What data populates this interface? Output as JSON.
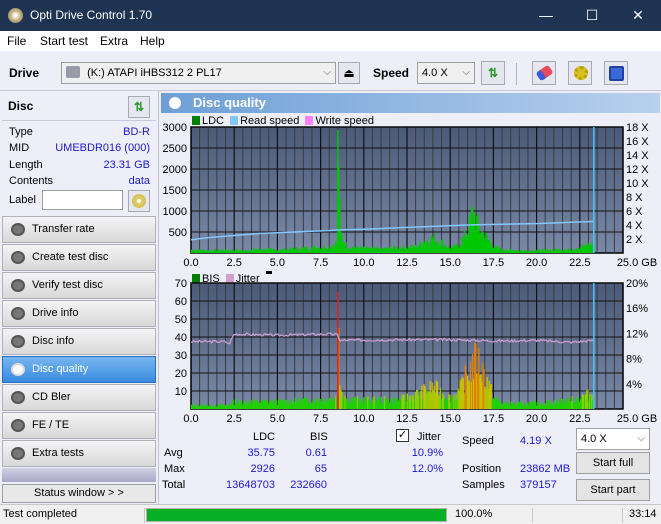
{
  "window": {
    "title": "Opti Drive Control 1.70",
    "minimize": "—",
    "maximize": "☐",
    "close": "✕"
  },
  "menu": [
    "File",
    "Start test",
    "Extra",
    "Help"
  ],
  "toolbar": {
    "drive_label": "Drive",
    "drive_value": "(K:)  ATAPI iHBS312   2 PL17",
    "speed_label": "Speed",
    "speed_value": "4.0 X"
  },
  "disc": {
    "title": "Disc",
    "rows": [
      {
        "label": "Type",
        "value": "BD-R"
      },
      {
        "label": "MID",
        "value": "UMEBDR016 (000)"
      },
      {
        "label": "Length",
        "value": "23.31 GB"
      },
      {
        "label": "Contents",
        "value": "data"
      }
    ],
    "label_field": "Label",
    "label_value": ""
  },
  "nav": [
    {
      "label": "Transfer rate",
      "active": false
    },
    {
      "label": "Create test disc",
      "active": false
    },
    {
      "label": "Verify test disc",
      "active": false
    },
    {
      "label": "Drive info",
      "active": false
    },
    {
      "label": "Disc info",
      "active": false
    },
    {
      "label": "Disc quality",
      "active": true
    },
    {
      "label": "CD Bler",
      "active": false
    },
    {
      "label": "FE / TE",
      "active": false
    },
    {
      "label": "Extra tests",
      "active": false
    }
  ],
  "status_window_btn": "Status window > >",
  "panel_title": "Disc quality",
  "colors": {
    "ldc": "#00c800",
    "read_speed": "#80c8ff",
    "write_speed": "#ff80ff",
    "bis": "#00c800",
    "jitter": "#d0a0d0",
    "plot_bg_top": "#4c5a7a",
    "plot_bg_bottom": "#7a88a8"
  },
  "chart_data": [
    {
      "type": "area",
      "title": "LDC / Read speed",
      "legend": [
        "LDC",
        "Read speed",
        "Write speed"
      ],
      "xlabel": "GB",
      "xlim": [
        0,
        25
      ],
      "ylim": [
        0,
        3000
      ],
      "y2lim": [
        0,
        18
      ],
      "x_ticks": [
        "0.0",
        "2.5",
        "5.0",
        "7.5",
        "10.0",
        "12.5",
        "15.0",
        "17.5",
        "20.0",
        "22.5",
        "25.0 GB"
      ],
      "y_ticks": [
        "500",
        "1000",
        "1500",
        "2000",
        "2500",
        "3000"
      ],
      "y2_ticks": [
        "2 X",
        "4 X",
        "6 X",
        "8 X",
        "10 X",
        "12 X",
        "14 X",
        "16 X",
        "18 X"
      ],
      "end_marker_gb": 23.31,
      "ldc_profile": [
        [
          0,
          80
        ],
        [
          1,
          60
        ],
        [
          2,
          70
        ],
        [
          3,
          60
        ],
        [
          4,
          90
        ],
        [
          5,
          70
        ],
        [
          6,
          100
        ],
        [
          7,
          130
        ],
        [
          8,
          150
        ],
        [
          8.4,
          250
        ],
        [
          8.5,
          2926
        ],
        [
          8.6,
          450
        ],
        [
          9,
          150
        ],
        [
          10,
          110
        ],
        [
          11,
          100
        ],
        [
          12,
          130
        ],
        [
          13,
          150
        ],
        [
          13.5,
          300
        ],
        [
          14,
          350
        ],
        [
          14.5,
          250
        ],
        [
          15,
          100
        ],
        [
          15.5,
          200
        ],
        [
          16,
          550
        ],
        [
          16.3,
          1000
        ],
        [
          16.6,
          600
        ],
        [
          17,
          400
        ],
        [
          17.5,
          150
        ],
        [
          18,
          80
        ],
        [
          19,
          60
        ],
        [
          20,
          60
        ],
        [
          21,
          80
        ],
        [
          22,
          90
        ],
        [
          23,
          200
        ],
        [
          23.31,
          200
        ]
      ],
      "read_speed_profile": [
        [
          0,
          1.9
        ],
        [
          1,
          2.2
        ],
        [
          2,
          2.4
        ],
        [
          3,
          2.6
        ],
        [
          4,
          2.8
        ],
        [
          5,
          2.9
        ],
        [
          6,
          3.0
        ],
        [
          7,
          3.1
        ],
        [
          8,
          3.2
        ],
        [
          8.5,
          3.3
        ],
        [
          10,
          3.4
        ],
        [
          12,
          3.6
        ],
        [
          14,
          3.8
        ],
        [
          16,
          4.0
        ],
        [
          18,
          4.1
        ],
        [
          20,
          4.2
        ],
        [
          22,
          4.4
        ],
        [
          23.31,
          4.5
        ]
      ]
    },
    {
      "type": "area",
      "title": "BIS / Jitter",
      "legend": [
        "BIS",
        "Jitter"
      ],
      "xlabel": "GB",
      "xlim": [
        0,
        25
      ],
      "ylim": [
        0,
        70
      ],
      "y2lim": [
        0,
        20
      ],
      "x_ticks": [
        "0.0",
        "2.5",
        "5.0",
        "7.5",
        "10.0",
        "12.5",
        "15.0",
        "17.5",
        "20.0",
        "22.5",
        "25.0 GB"
      ],
      "y_ticks": [
        "10",
        "20",
        "30",
        "40",
        "50",
        "60",
        "70"
      ],
      "y2_ticks": [
        "4%",
        "8%",
        "12%",
        "16%",
        "20%"
      ],
      "end_marker_gb": 23.31,
      "bis_profile": [
        [
          0,
          2
        ],
        [
          2,
          2
        ],
        [
          2.5,
          4
        ],
        [
          5,
          4
        ],
        [
          7,
          5
        ],
        [
          8.4,
          6
        ],
        [
          8.5,
          65
        ],
        [
          8.6,
          12
        ],
        [
          9,
          5
        ],
        [
          12,
          5
        ],
        [
          13,
          8
        ],
        [
          14,
          12
        ],
        [
          15,
          6
        ],
        [
          15.5,
          10
        ],
        [
          16,
          20
        ],
        [
          16.5,
          28
        ],
        [
          17,
          18
        ],
        [
          17.5,
          6
        ],
        [
          18,
          3
        ],
        [
          20,
          3
        ],
        [
          22,
          5
        ],
        [
          23,
          8
        ],
        [
          23.31,
          8
        ]
      ],
      "jitter_profile": [
        [
          0,
          10.7
        ],
        [
          2,
          10.7
        ],
        [
          2.2,
          10.3
        ],
        [
          2.5,
          11.9
        ],
        [
          5,
          11.7
        ],
        [
          8,
          11.9
        ],
        [
          8.5,
          11.8
        ],
        [
          8.6,
          10.9
        ],
        [
          12,
          11.0
        ],
        [
          15,
          11.0
        ],
        [
          18,
          10.8
        ],
        [
          20,
          10.9
        ],
        [
          22,
          10.6
        ],
        [
          23.31,
          10.9
        ]
      ]
    }
  ],
  "stats": {
    "col_ldc": "LDC",
    "col_bis": "BIS",
    "jitter_label": "Jitter",
    "jitter_checked": true,
    "rows": [
      {
        "label": "Avg",
        "ldc": "35.75",
        "bis": "0.61",
        "jitter": "10.9%"
      },
      {
        "label": "Max",
        "ldc": "2926",
        "bis": "65",
        "jitter": "12.0%"
      },
      {
        "label": "Total",
        "ldc": "13648703",
        "bis": "232660",
        "jitter": ""
      }
    ],
    "speed_label": "Speed",
    "speed_value": "4.19 X",
    "position_label": "Position",
    "position_value": "23862 MB",
    "samples_label": "Samples",
    "samples_value": "379157",
    "speed_select": "4.0 X",
    "start_full": "Start full",
    "start_part": "Start part"
  },
  "statusbar": {
    "text": "Test completed",
    "progress": 100.0,
    "progress_text": "100.0%",
    "time": "33:14"
  }
}
